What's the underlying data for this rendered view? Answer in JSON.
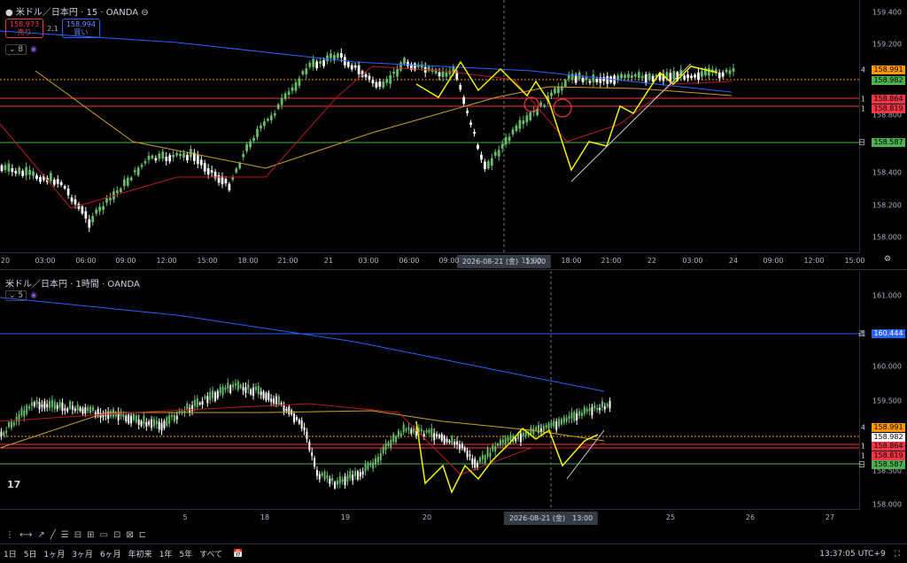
{
  "pane1": {
    "title": "米ドル／日本円 · 15 · OANDA",
    "sell_price": "158.973",
    "sell_label": "売り",
    "spread": "2.1",
    "buy_price": "158.994",
    "buy_label": "買い",
    "indicator_count": "8",
    "yaxis_labels": [
      "159.400",
      "159.200",
      "159.000",
      "158.800",
      "158.600",
      "158.400",
      "158.200",
      "158.000"
    ],
    "xaxis_labels": [
      "20",
      "03:00",
      "06:00",
      "09:00",
      "12:00",
      "15:00",
      "18:00",
      "21:00",
      "21",
      "03:00",
      "06:00",
      "09:00",
      "15:00",
      "18:00",
      "21:00",
      "22",
      "03:00",
      "24",
      "09:00",
      "12:00",
      "15:00"
    ],
    "crosshair_time": "2026-08-21 (金)　13:00",
    "tags": [
      {
        "value": "158.991",
        "color": "#ff9800",
        "mark": "4"
      },
      {
        "value": "158.982",
        "color": "#4caf50",
        "mark": ""
      },
      {
        "value": "158.864",
        "color": "#f23645",
        "mark": "1"
      },
      {
        "value": "158.819",
        "color": "#f23645",
        "mark": "1"
      },
      {
        "value": "158.587",
        "color": "#4caf50",
        "mark": "日"
      }
    ]
  },
  "pane2": {
    "title": "米ドル／日本円 · 1時間 · OANDA",
    "indicator_count": "5",
    "yaxis_labels": [
      "161.000",
      "160.000",
      "159.500",
      "158.500",
      "158.000"
    ],
    "xaxis_labels": [
      "5",
      "18",
      "19",
      "20",
      "25",
      "26",
      "27"
    ],
    "crosshair_time": "2026-08-21 (金)　13:00",
    "tags": [
      {
        "value": "160.444",
        "color": "#2962ff",
        "mark": "週"
      },
      {
        "value": "158.991",
        "color": "#ff9800",
        "mark": "4"
      },
      {
        "value": "158.982",
        "color": "#ffffff",
        "mark": ""
      },
      {
        "value": "158.864",
        "color": "#f23645",
        "mark": "1"
      },
      {
        "value": "158.819",
        "color": "#f23645",
        "mark": "1"
      },
      {
        "value": "158.587",
        "color": "#4caf50",
        "mark": "日"
      }
    ]
  },
  "bottom": {
    "ranges": [
      "1日",
      "5日",
      "1ヶ月",
      "3ヶ月",
      "6ヶ月",
      "年初来",
      "1年",
      "5年",
      "すべて"
    ],
    "clock": "13:37:05 UTC+9"
  },
  "colors": {
    "up": "#26a69a",
    "down": "#ef5350",
    "candle_up": "#66bb6a",
    "candle_down": "#ffffff",
    "ma_blue": "#2962ff",
    "ma_yellow": "#c9a227",
    "ma_red": "#b71c1c",
    "zigzag": "#f5f500"
  }
}
